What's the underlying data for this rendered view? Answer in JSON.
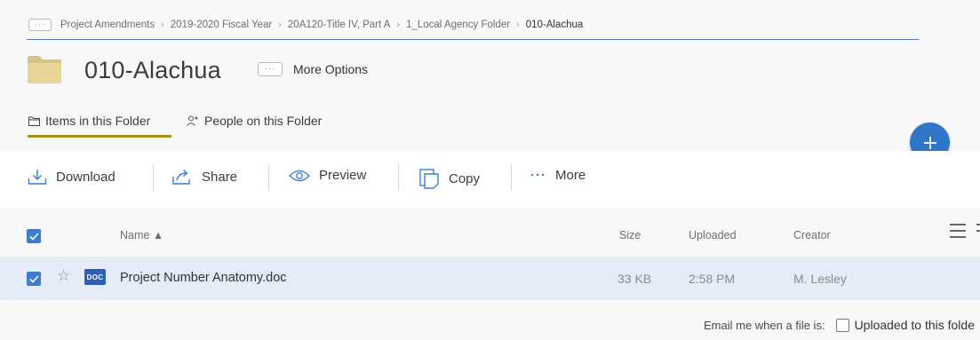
{
  "breadcrumb": {
    "overflow_label": "···",
    "items": [
      "Project Amendments",
      "2019-2020 Fiscal Year",
      "20A120-Title IV, Part A",
      "1_Local Agency Folder",
      "010-Alachua"
    ]
  },
  "folder": {
    "title": "010-Alachua",
    "more_options_dots": "···",
    "more_options_label": "More Options"
  },
  "tabs": [
    {
      "label": "Items in this Folder",
      "icon": "folder-outline-icon",
      "active": true
    },
    {
      "label": "People on this Folder",
      "icon": "people-icon",
      "active": false
    }
  ],
  "fab": {
    "icon": "plus-icon"
  },
  "toolbar": {
    "download": "Download",
    "share": "Share",
    "preview": "Preview",
    "copy": "Copy",
    "more_dots": "···",
    "more": "More"
  },
  "table": {
    "columns": {
      "name": "Name ▲",
      "size": "Size",
      "uploaded": "Uploaded",
      "creator": "Creator"
    },
    "rows": [
      {
        "type_badge": "DOC",
        "name": "Project Number Anatomy.doc",
        "size": "33 KB",
        "uploaded": "2:58 PM",
        "creator": "M. Lesley",
        "selected": true,
        "starred": false
      }
    ]
  },
  "footer": {
    "email_prompt": "Email me when a file is:",
    "option_uploaded": "Uploaded to this folde"
  },
  "colors": {
    "accent": "#2f75c8",
    "tab_underline": "#a89020",
    "selected_row": "#e4edf7"
  }
}
